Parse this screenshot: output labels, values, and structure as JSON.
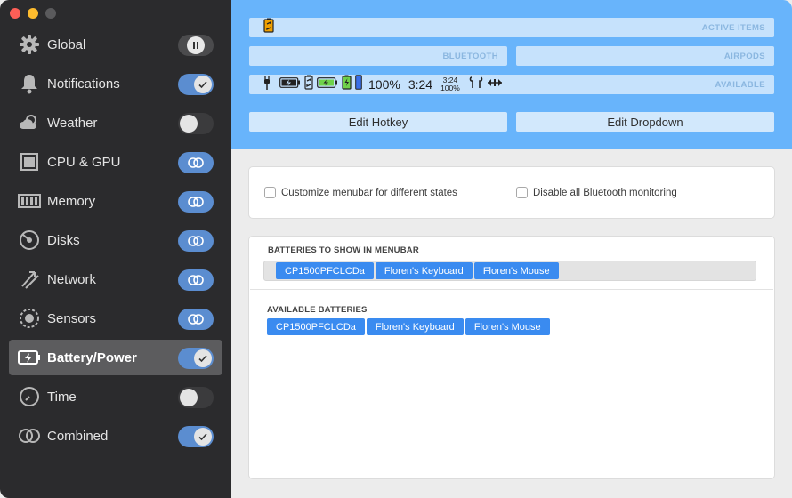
{
  "sidebar": {
    "items": [
      {
        "label": "Global",
        "icon": "gear-icon",
        "toggle": "pause"
      },
      {
        "label": "Notifications",
        "icon": "bell-icon",
        "toggle": "check"
      },
      {
        "label": "Weather",
        "icon": "cloud-icon",
        "toggle": "off"
      },
      {
        "label": "CPU & GPU",
        "icon": "cpu-icon",
        "toggle": "linked"
      },
      {
        "label": "Memory",
        "icon": "memory-icon",
        "toggle": "linked"
      },
      {
        "label": "Disks",
        "icon": "disk-icon",
        "toggle": "linked"
      },
      {
        "label": "Network",
        "icon": "network-icon",
        "toggle": "linked"
      },
      {
        "label": "Sensors",
        "icon": "fan-icon",
        "toggle": "linked"
      },
      {
        "label": "Battery/Power",
        "icon": "battery-icon",
        "toggle": "check",
        "active": true
      },
      {
        "label": "Time",
        "icon": "clock-icon",
        "toggle": "off"
      },
      {
        "label": "Combined",
        "icon": "rings-icon",
        "toggle": "check"
      }
    ]
  },
  "header": {
    "active_items_label": "ACTIVE ITEMS",
    "bluetooth_label": "BLUETOOTH",
    "airpods_label": "AIRPODS",
    "available_label": "AVAILABLE",
    "available_percent": "100%",
    "available_time": "3:24",
    "available_small_time": "3:24",
    "available_small_percent": "100%",
    "edit_hotkey": "Edit Hotkey",
    "edit_dropdown": "Edit Dropdown"
  },
  "options": {
    "customize_label": "Customize menubar for different states",
    "disable_bt_label": "Disable all Bluetooth monitoring"
  },
  "batteries": {
    "menubar_title": "BATTERIES TO SHOW IN MENUBAR",
    "menubar_items": [
      "CP1500PFCLCDa",
      "Floren's Keyboard",
      "Floren's Mouse"
    ],
    "available_title": "AVAILABLE BATTERIES",
    "available_items": [
      "CP1500PFCLCDa",
      "Floren's Keyboard",
      "Floren's Mouse"
    ]
  },
  "colors": {
    "sidebar_bg": "#2b2b2d",
    "header_bg": "#68b4fb",
    "toggle_on": "#5b8dd0",
    "chip": "#3a8bf0"
  }
}
